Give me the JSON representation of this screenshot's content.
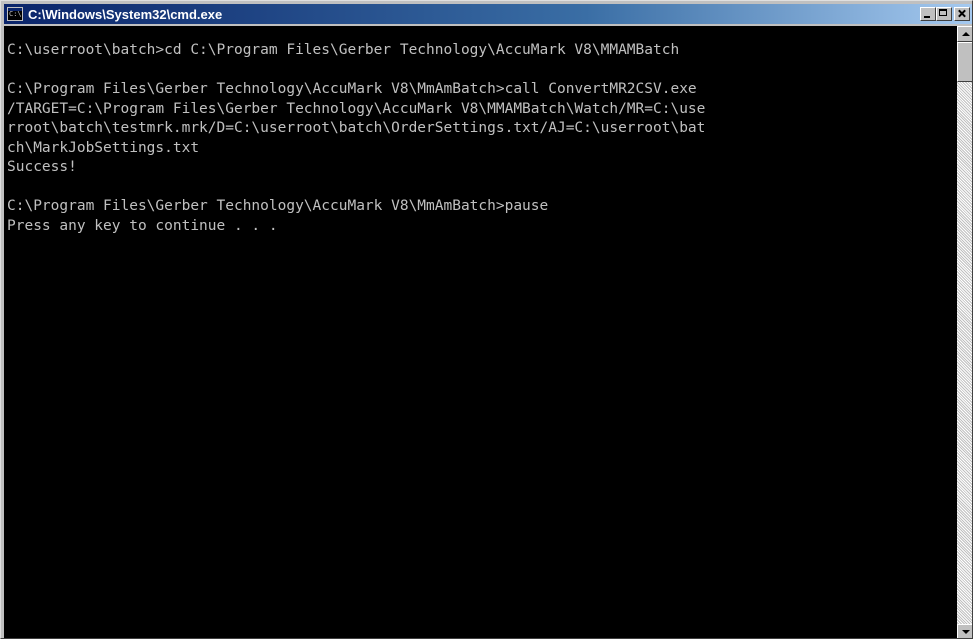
{
  "window": {
    "title": "C:\\Windows\\System32\\cmd.exe",
    "icon": "console-icon",
    "buttons": {
      "minimize": "minimize-icon",
      "maximize": "maximize-icon",
      "close": "close-icon"
    }
  },
  "console": {
    "colors": {
      "background": "#000000",
      "text": "#c0c0c0"
    },
    "lines": [
      "C:\\userroot\\batch>cd C:\\Program Files\\Gerber Technology\\AccuMark V8\\MMAMBatch",
      "",
      "C:\\Program Files\\Gerber Technology\\AccuMark V8\\MmAmBatch>call ConvertMR2CSV.exe",
      "/TARGET=C:\\Program Files\\Gerber Technology\\AccuMark V8\\MMAMBatch\\Watch/MR=C:\\use",
      "rroot\\batch\\testmrk.mrk/D=C:\\userroot\\batch\\OrderSettings.txt/AJ=C:\\userroot\\bat",
      "ch\\MarkJobSettings.txt",
      "Success!",
      "",
      "C:\\Program Files\\Gerber Technology\\AccuMark V8\\MmAmBatch>pause",
      "Press any key to continue . . ."
    ]
  },
  "scrollbar": {
    "up_icon": "arrow-up-icon",
    "down_icon": "arrow-down-icon"
  }
}
